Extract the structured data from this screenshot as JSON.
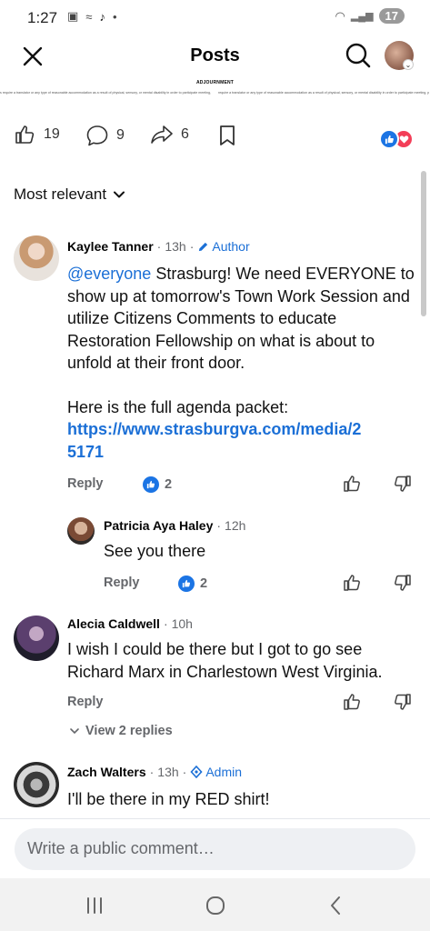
{
  "status": {
    "time": "1:27",
    "battery": "17"
  },
  "header": {
    "title": "Posts"
  },
  "document": {
    "heading": "ADJOURNMENT",
    "line_left": "s require a translator or any type of reasonable accommodation as a result of physical, sensory, or mental disability in order to participate meeting, please contact Jennifer Bricutt, Clerk of Council, at 540-465-9197 or jcbricutt@strasburgva.com. Three days' notice is required.",
    "line_right": "require a translator or any type of reasonable accommodation as a result of physical, sensory, or mental disability in order to participate meeting, please contact Jennifer Bricutt, Clerk of Council, at 540-465-9197 or jcbricutt@strasburgva.com. Three days' notice is required."
  },
  "post_actions": {
    "likes": "19",
    "comments": "9",
    "shares": "6"
  },
  "sort": {
    "label": "Most relevant"
  },
  "comments": [
    {
      "name": "Kaylee Tanner",
      "time": "13h",
      "badge": "Author",
      "mention": "@everyone",
      "text_after_mention": " Strasburg! We need EVERYONE to show up at tomorrow's Town Work Session and utilize Citizens Comments to educate Restoration Fellowship on what is about to unfold at their front door.",
      "text2": "Here is the full agenda packet:",
      "link": "https://www.strasburgva.com/media/25171",
      "reply_label": "Reply",
      "like_count": "2"
    },
    {
      "name": "Patricia Aya Haley",
      "time": "12h",
      "text": "See you there",
      "reply_label": "Reply",
      "like_count": "2"
    },
    {
      "name": "Alecia Caldwell",
      "time": "10h",
      "text": "I wish I could be there but I got to go see Richard Marx in Charlestown West Virginia.",
      "reply_label": "Reply",
      "view_replies": "View 2 replies"
    },
    {
      "name": "Zach Walters",
      "time": "13h",
      "badge": "Admin",
      "text": "I'll be there in my RED shirt!"
    }
  ],
  "composer": {
    "placeholder": "Write a public comment…"
  },
  "colors": {
    "link": "#1b6fd6",
    "like": "#1b74e4",
    "love": "#f33e58"
  }
}
